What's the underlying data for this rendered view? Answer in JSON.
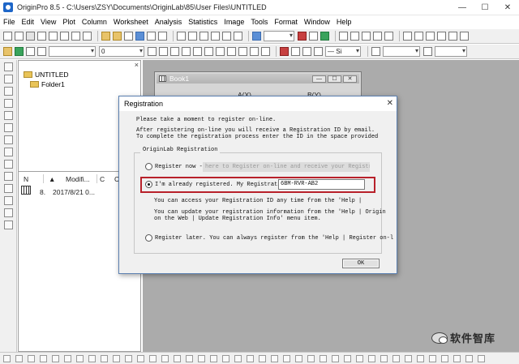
{
  "window": {
    "title": "OriginPro 8.5 - C:\\Users\\ZSY\\Documents\\OriginLab\\85\\User Files\\UNTITLED",
    "minimize": "—",
    "maximize": "☐",
    "close": "✕"
  },
  "menu": [
    "File",
    "Edit",
    "View",
    "Plot",
    "Column",
    "Worksheet",
    "Analysis",
    "Statistics",
    "Image",
    "Tools",
    "Format",
    "Window",
    "Help"
  ],
  "toolbar2": {
    "size_combo": "0",
    "line_combo": "— Si"
  },
  "explorer": {
    "close": "×",
    "root": "UNTITLED",
    "folder": "Folder1"
  },
  "filelist": {
    "col_name": "N",
    "col_modified": "Modifi...",
    "col_c": "C",
    "col_more": "Co",
    "row": {
      "number": "8.",
      "modified": "2017/8/21 0..."
    }
  },
  "book": {
    "title": "Book1",
    "col_a": "A(X)",
    "col_b": "B(Y)"
  },
  "dialog": {
    "title": "Registration",
    "close": "✕",
    "intro": "Please take a moment to register on-line.",
    "info1": "After registering on-line you will receive a Registration ID by email.",
    "info2": "To complete the registration process enter the ID in the space provided",
    "group_label": "OriginLab Registration",
    "register_now": "Register now -",
    "register_link": "here to Register on-line and receive your Registrat",
    "already_label": "I'm already registered. My Registratio",
    "registration_id": "6BM-RVR-AB2",
    "access_note": "You can access your Registration ID any time from the 'Help |",
    "update_note1": "You can update your registration information from the 'Help | Origin",
    "update_note2": "on the Web | Update Registration Info' menu item.",
    "register_later": "Register later. You can always register from the 'Help | Register on-l",
    "ok": "OK"
  },
  "watermark": {
    "text": "软件智库"
  },
  "colors": {
    "highlight": "#b8212a",
    "workspace": "#ababab",
    "chrome": "#f0f0f0"
  }
}
